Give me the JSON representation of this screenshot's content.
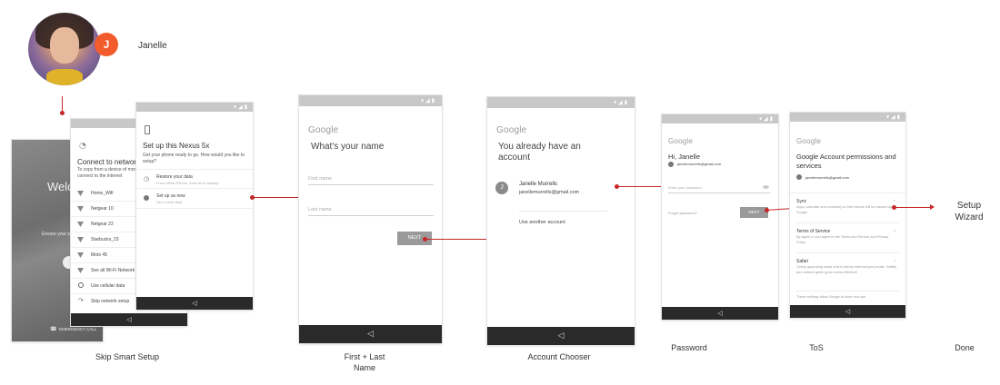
{
  "user": {
    "name": "Janelle",
    "badge": "J"
  },
  "labels": {
    "skip_smart_setup": "Skip Smart Setup",
    "first_last_name": "First + Last\nName",
    "account_chooser": "Account Chooser",
    "password": "Password",
    "tos": "ToS",
    "done": "Done",
    "setup_wizard": "Setup\nWizard"
  },
  "welcome_screen": {
    "title": "Welco",
    "sub": "Ensure your pl",
    "emergency": "EMERGENCY CALL"
  },
  "network_screen": {
    "title": "Connect to network",
    "desc": "To copy from a device of mor connect to the internet",
    "networks": [
      "Home_Wifi",
      "Netgear 10",
      "Netgear 22",
      "Starbucks_23",
      "Moto 45",
      "See all Wi-Fi Network",
      "Use cellular data",
      "Skip network setup"
    ]
  },
  "nexus_screen": {
    "title": "Set up this Nexus 5x",
    "desc": "Get your phone ready to go. How would you like to setup?",
    "option1_title": "Restore your data",
    "option1_sub": "From either iPhone, Android or backup",
    "option2_title": "Set up as new",
    "option2_sub": "Set a fresh start"
  },
  "name_screen": {
    "logo": "Google",
    "title": "What's your name",
    "first_name_placeholder": "First name",
    "last_name_placeholder": "Last name",
    "next": "NEXT"
  },
  "account_screen": {
    "logo": "Google",
    "title": "You already have an account",
    "account_initial": "J",
    "account_name": "Janelle Murrells",
    "account_email": "janellemurrells@gmail.com",
    "use_another": "Use another account"
  },
  "password_screen": {
    "logo": "Google",
    "greeting": "Hi, Janelle",
    "email": "janellemurrells@gmail.com",
    "password_placeholder": "Enter your password",
    "forgot": "Forgot password?",
    "next": "NEXT"
  },
  "tos_screen": {
    "logo": "Google",
    "title": "Google Account permissions and services",
    "email": "janellemurrells@gmail.com",
    "sync_title": "Sync",
    "sync_desc": "Apps, calendar and contacts) on their device will be backed up to Google",
    "terms_title": "Terms of Service",
    "terms_desc": "By signin in you agree to the Terms and Service and Privacy Policy",
    "safari_title": "Safari",
    "safari_desc": "Celery quandong swiss chard chicory earthnut pea potato. Salsify taro catsear garlic gram celery bitterleaf",
    "footer": "These settings allow Google to store and use"
  }
}
